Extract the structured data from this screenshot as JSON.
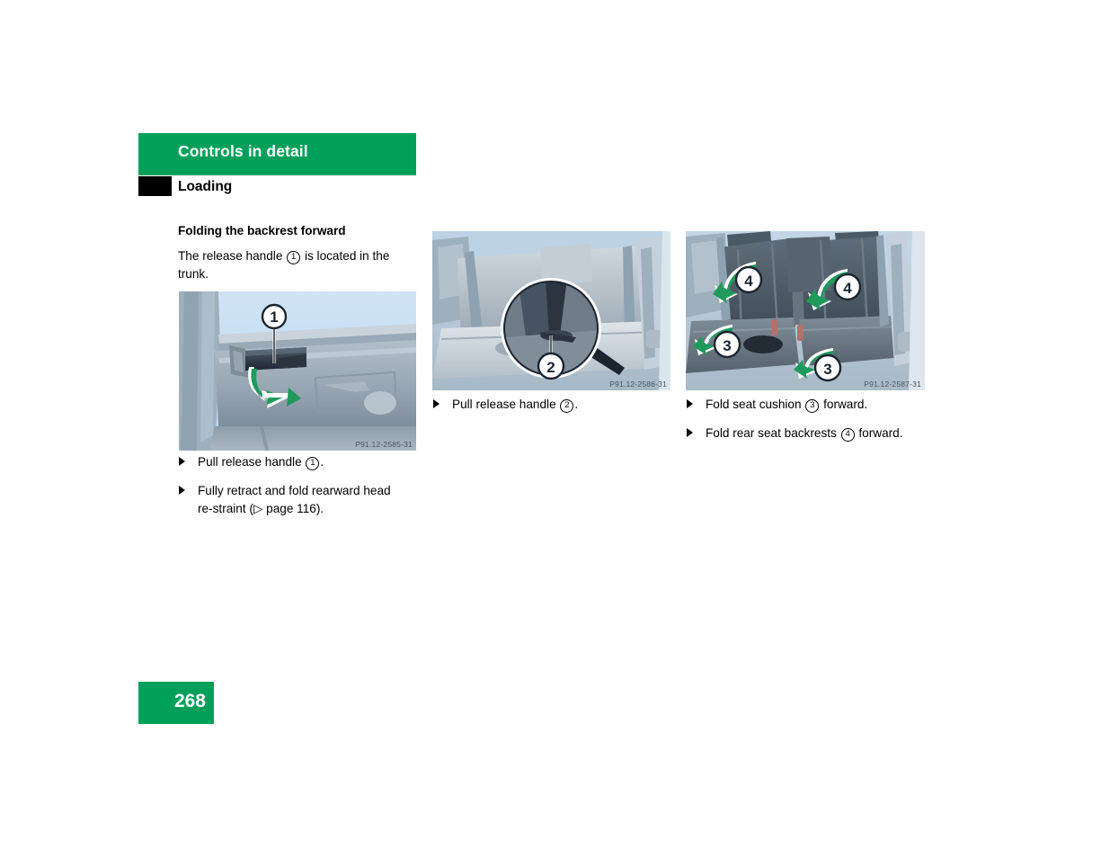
{
  "header": {
    "chapter_title": "Controls in detail",
    "section_title": "Loading",
    "bar_color": "#00a05b",
    "tab_color": "#000000"
  },
  "left_column": {
    "sub_heading": "Folding the backrest forward",
    "intro_before": "The release handle",
    "intro_ref": "1",
    "intro_after": "is located in the trunk.",
    "figure": {
      "code": "P91.12-2585-31",
      "callout": "1",
      "alt": "Trunk interior showing release handle with green pull arrow"
    },
    "bullets": [
      {
        "before": "Pull release handle",
        "ref": "1",
        "after": "."
      },
      {
        "before": "Fully retract and fold rearward head re‑straint (",
        "ref": "",
        "after": "▷ page 116)."
      }
    ]
  },
  "middle_column": {
    "figure": {
      "code": "P91.12-2586-31",
      "callout": "2",
      "alt": "Rear seat with magnified detail circle showing release handle"
    },
    "bullets": [
      {
        "before": "Pull release handle",
        "ref": "2",
        "after": "."
      }
    ]
  },
  "right_column": {
    "figure": {
      "code": "P91.12-2587-31",
      "callouts": [
        "4",
        "4",
        "3",
        "3"
      ],
      "alt": "Rear seats with green folding arrows for seat cushion and backrests"
    },
    "bullets": [
      {
        "before": "Fold seat cushion",
        "ref": "3",
        "after": "forward."
      },
      {
        "before": "Fold rear seat backrests",
        "ref": "4",
        "after": "forward."
      }
    ]
  },
  "footer": {
    "page_number": "268",
    "box_color": "#00a05b"
  },
  "colors": {
    "brand_green": "#00a05b",
    "arrow_green": "#1f9a5c",
    "text": "#000000",
    "code_gray": "#4a5560"
  }
}
